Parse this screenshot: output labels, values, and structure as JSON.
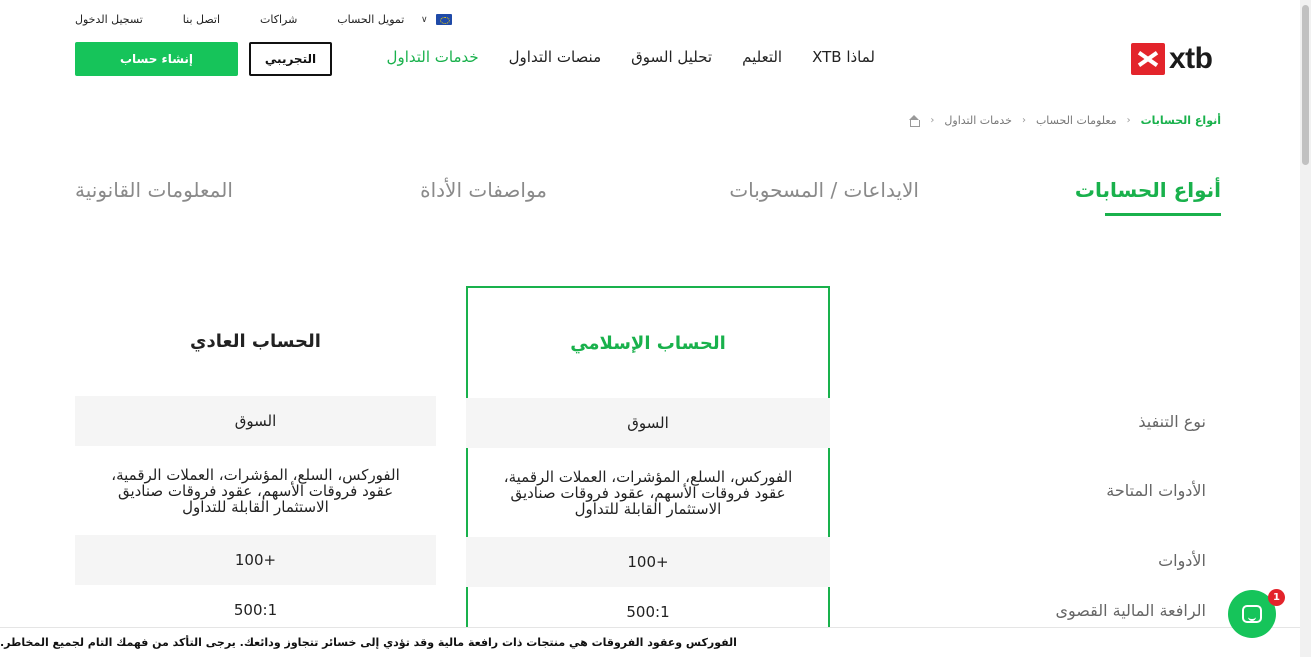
{
  "topbar": {
    "links": [
      "تسجيل الدخول",
      "اتصل بنا",
      "شراكات",
      "تمويل الحساب"
    ]
  },
  "brand": {
    "name": "xtb",
    "accent": "#e3242b"
  },
  "nav": {
    "items": [
      "خدمات التداول",
      "منصات التداول",
      "تحليل السوق",
      "التعليم",
      "لماذا XTB"
    ],
    "active_color": "#19b14c"
  },
  "buttons": {
    "demo": "التجريبي",
    "open_account": "إنشاء حساب"
  },
  "breadcrumb": [
    "خدمات التداول",
    "معلومات الحساب",
    "أنواع الحسابات"
  ],
  "tabs": [
    "أنواع الحسابات",
    "الايداعات / المسحوبات",
    "مواصفات الأداة",
    "المعلومات القانونية"
  ],
  "table": {
    "row_labels": [
      "نوع التنفيذ",
      "الأدوات المتاحة",
      "الأدوات",
      "الرافعة المالية القصوى"
    ],
    "columns": {
      "islamic": {
        "title": "الحساب الإسلامي",
        "cells": [
          "السوق",
          "الفوركس، السلع، المؤشرات، العملات الرقمية، عقود فروقات الأسهم، عقود فروقات صناديق الاستثمار القابلة للتداول",
          "+100",
          "500:1"
        ]
      },
      "standard": {
        "title": "الحساب العادي",
        "cells": [
          "السوق",
          "الفوركس، السلع، المؤشرات، العملات الرقمية، عقود فروقات الأسهم، عقود فروقات صناديق الاستثمار القابلة للتداول",
          "+100",
          "500:1"
        ]
      }
    }
  },
  "risk_warning": "الفوركس وعقود الفروقات هي منتجات ذات رافعة مالية وقد تؤدي إلى خسائر تتجاوز ودائعك. يرجى التأكد من فهمك التام لجميع المخاطر.",
  "chat": {
    "badge": "1"
  },
  "colors": {
    "green": "#19b14c",
    "button_green": "#16c45a",
    "red": "#e3242b"
  }
}
